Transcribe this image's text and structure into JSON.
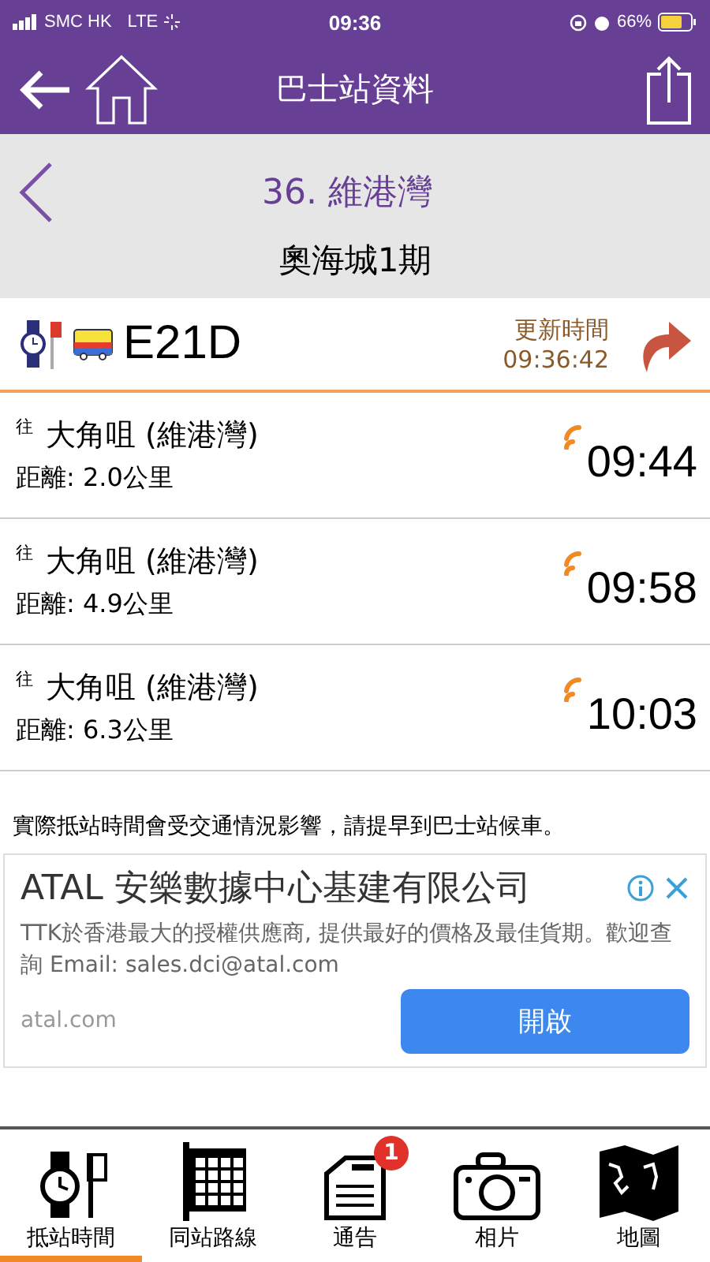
{
  "status_bar": {
    "carrier": "SMC HK",
    "network": "LTE",
    "time": "09:36",
    "battery": "66%"
  },
  "nav": {
    "title": "巴士站資料"
  },
  "stop": {
    "name": "36. 維港灣",
    "subname": "奧海城1期"
  },
  "route": {
    "number": "E21D",
    "updated_label": "更新時間",
    "updated_time": "09:36:42"
  },
  "arrivals": [
    {
      "to_label": "往",
      "destination": "大角咀 (維港灣)",
      "distance": "距離: 2.0公里",
      "time": "09:44"
    },
    {
      "to_label": "往",
      "destination": "大角咀 (維港灣)",
      "distance": "距離: 4.9公里",
      "time": "09:58"
    },
    {
      "to_label": "往",
      "destination": "大角咀 (維港灣)",
      "distance": "距離: 6.3公里",
      "time": "10:03"
    }
  ],
  "notice": "實際抵站時間會受交通情況影響，請提早到巴士站候車。",
  "ad": {
    "title": "ATAL 安樂數據中心基建有限公司",
    "body": "TTK於香港最大的授權供應商, 提供最好的價格及最佳貨期。歡迎查詢 Email: sales.dci@atal.com",
    "domain": "atal.com",
    "button": "開啟"
  },
  "tabs": [
    {
      "kind": "clock",
      "label": "抵站時間",
      "selected": true
    },
    {
      "kind": "grid",
      "label": "同站路線",
      "selected": false
    },
    {
      "kind": "notice",
      "label": "通告",
      "selected": false,
      "badge": "1"
    },
    {
      "kind": "camera",
      "label": "相片",
      "selected": false
    },
    {
      "kind": "map",
      "label": "地圖",
      "selected": false
    }
  ]
}
